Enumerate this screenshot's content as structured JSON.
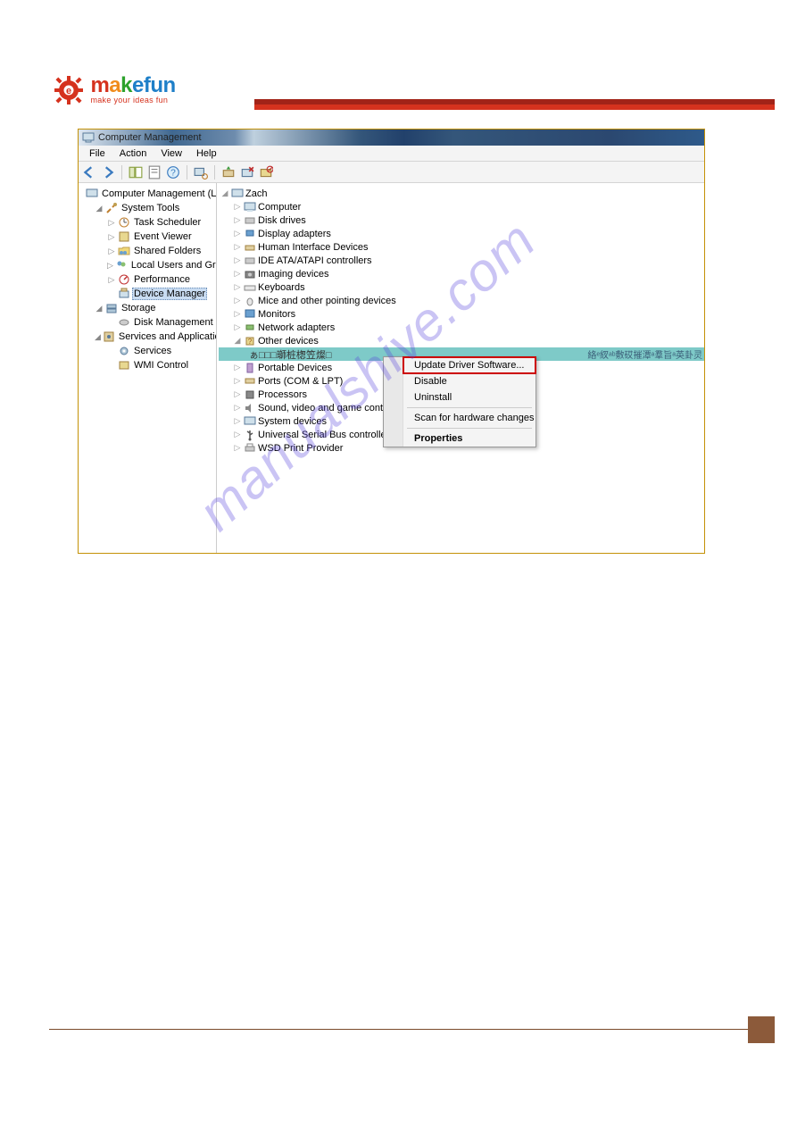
{
  "logo": {
    "main_m": "m",
    "main_a": "a",
    "main_k": "k",
    "main_e": "e",
    "main_f": "f",
    "main_u": "u",
    "main_n": "n",
    "sub": "make your ideas fun"
  },
  "window": {
    "title": "Computer Management"
  },
  "menu": {
    "file": "File",
    "action": "Action",
    "view": "View",
    "help": "Help"
  },
  "left": {
    "root": "Computer Management (Local",
    "systools": "System Tools",
    "task": "Task Scheduler",
    "event": "Event Viewer",
    "shared": "Shared Folders",
    "users": "Local Users and Groups",
    "perf": "Performance",
    "devmgr": "Device Manager",
    "storage": "Storage",
    "diskmgmt": "Disk Management",
    "svcapps": "Services and Applications",
    "services": "Services",
    "wmi": "WMI Control"
  },
  "right": {
    "root": "Zach",
    "computer": "Computer",
    "diskdrives": "Disk drives",
    "display": "Display adapters",
    "hid": "Human Interface Devices",
    "ide": "IDE ATA/ATAPI controllers",
    "imaging": "Imaging devices",
    "keyboards": "Keyboards",
    "mice": "Mice and other pointing devices",
    "monitors": "Monitors",
    "network": "Network adapters",
    "other": "Other devices",
    "other_item": "ぁ□□□瑡桩楤笠燦□",
    "garbled": "絡ᵉ紁ᵃᵇ敷砹摧潭ᵃ羣旨ᵃ英卦灵",
    "portable": "Portable Devices",
    "ports": "Ports (COM & LPT)",
    "processors": "Processors",
    "sound": "Sound, video and game contro",
    "sysdev": "System devices",
    "usb": "Universal Serial Bus controllers",
    "wsd": "WSD Print Provider"
  },
  "context": {
    "update": "Update Driver Software...",
    "disable": "Disable",
    "uninstall": "Uninstall",
    "scan": "Scan for hardware changes",
    "properties": "Properties"
  },
  "watermark": "manualshive.com"
}
